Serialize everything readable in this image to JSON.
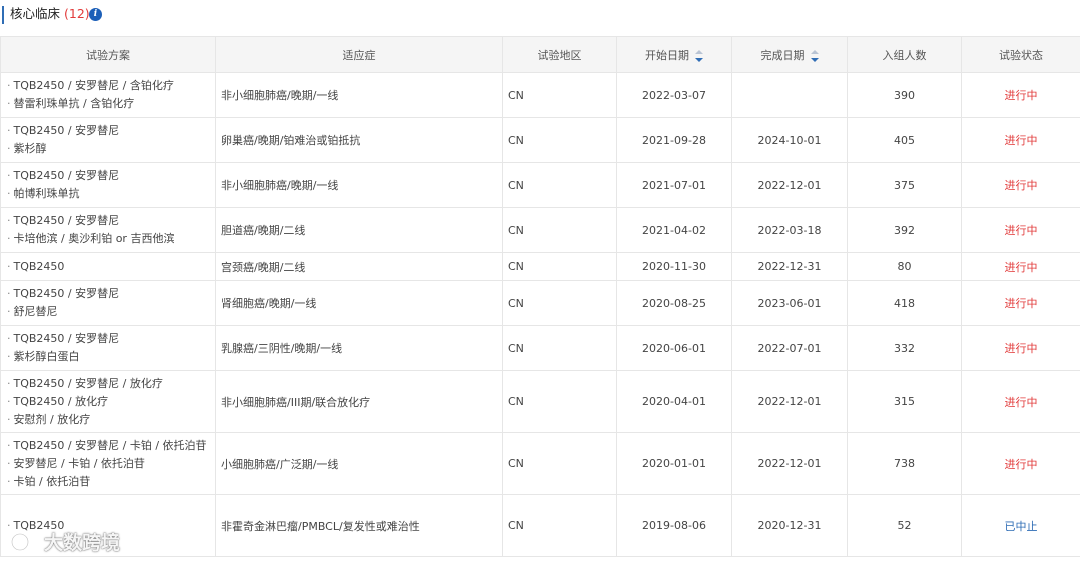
{
  "header": {
    "title": "核心临床",
    "count": "(12)",
    "info_icon": "info-icon"
  },
  "columns": [
    {
      "label": "试验方案"
    },
    {
      "label": "适应症"
    },
    {
      "label": "试验地区"
    },
    {
      "label": "开始日期",
      "sortable": true
    },
    {
      "label": "完成日期",
      "sortable": true
    },
    {
      "label": "入组人数"
    },
    {
      "label": "试验状态"
    }
  ],
  "rows": [
    {
      "plan": [
        "TQB2450 / 安罗替尼 / 含铂化疗",
        "替雷利珠单抗 / 含铂化疗"
      ],
      "indication": "非小细胞肺癌/晚期/一线",
      "region": "CN",
      "start": "2022-03-07",
      "end": "",
      "enrolled": "390",
      "status": "进行中",
      "status_type": "ongoing"
    },
    {
      "plan": [
        "TQB2450 / 安罗替尼",
        "紫杉醇"
      ],
      "indication": "卵巢癌/晚期/铂难治或铂抵抗",
      "region": "CN",
      "start": "2021-09-28",
      "end": "2024-10-01",
      "enrolled": "405",
      "status": "进行中",
      "status_type": "ongoing"
    },
    {
      "plan": [
        "TQB2450 / 安罗替尼",
        "帕博利珠单抗"
      ],
      "indication": "非小细胞肺癌/晚期/一线",
      "region": "CN",
      "start": "2021-07-01",
      "end": "2022-12-01",
      "enrolled": "375",
      "status": "进行中",
      "status_type": "ongoing"
    },
    {
      "plan": [
        "TQB2450 / 安罗替尼",
        "卡培他滨 / 奥沙利铂 or 吉西他滨"
      ],
      "indication": "胆道癌/晚期/二线",
      "region": "CN",
      "start": "2021-04-02",
      "end": "2022-03-18",
      "enrolled": "392",
      "status": "进行中",
      "status_type": "ongoing"
    },
    {
      "plan": [
        "TQB2450"
      ],
      "indication": "宫颈癌/晚期/二线",
      "region": "CN",
      "start": "2020-11-30",
      "end": "2022-12-31",
      "enrolled": "80",
      "status": "进行中",
      "status_type": "ongoing"
    },
    {
      "plan": [
        "TQB2450 / 安罗替尼",
        "舒尼替尼"
      ],
      "indication": "肾细胞癌/晚期/一线",
      "region": "CN",
      "start": "2020-08-25",
      "end": "2023-06-01",
      "enrolled": "418",
      "status": "进行中",
      "status_type": "ongoing"
    },
    {
      "plan": [
        "TQB2450 / 安罗替尼",
        "紫杉醇白蛋白"
      ],
      "indication": "乳腺癌/三阴性/晚期/一线",
      "region": "CN",
      "start": "2020-06-01",
      "end": "2022-07-01",
      "enrolled": "332",
      "status": "进行中",
      "status_type": "ongoing"
    },
    {
      "plan": [
        "TQB2450 / 安罗替尼 / 放化疗",
        "TQB2450 / 放化疗",
        "安慰剂 / 放化疗"
      ],
      "indication": "非小细胞肺癌/III期/联合放化疗",
      "region": "CN",
      "start": "2020-04-01",
      "end": "2022-12-01",
      "enrolled": "315",
      "status": "进行中",
      "status_type": "ongoing"
    },
    {
      "plan": [
        "TQB2450 / 安罗替尼 / 卡铂 / 依托泊苷",
        "安罗替尼 / 卡铂 / 依托泊苷",
        "卡铂 / 依托泊苷"
      ],
      "indication": "小细胞肺癌/广泛期/一线",
      "region": "CN",
      "start": "2020-01-01",
      "end": "2022-12-01",
      "enrolled": "738",
      "status": "进行中",
      "status_type": "ongoing"
    },
    {
      "plan": [
        "TQB2450"
      ],
      "indication": "非霍奇金淋巴瘤/PMBCL/复发性或难治性",
      "region": "CN",
      "start": "2019-08-06",
      "end": "2020-12-31",
      "enrolled": "52",
      "status": "已中止",
      "status_type": "stopped"
    }
  ],
  "watermark": {
    "text": "大数跨境"
  },
  "colors": {
    "accent": "#2f6db5",
    "ongoing": "#e23b3b",
    "stopped": "#2f6db5",
    "header_bg": "#f5f5f5"
  }
}
